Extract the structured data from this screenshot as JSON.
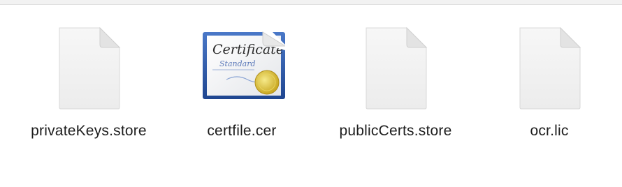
{
  "files": [
    {
      "name": "privateKeys.store",
      "icon": "generic-document-icon"
    },
    {
      "name": "certfile.cer",
      "icon": "certificate-icon",
      "certificate_text": "Certificate",
      "certificate_subtext": "Standard"
    },
    {
      "name": "publicCerts.store",
      "icon": "generic-document-icon"
    },
    {
      "name": "ocr.lic",
      "icon": "generic-document-icon"
    }
  ],
  "colors": {
    "background": "#ffffff",
    "label": "#1d1d1d",
    "doc_fill": "#f4f4f4",
    "cert_frame": "#2d5aa8",
    "seal": "#d9c23a"
  }
}
